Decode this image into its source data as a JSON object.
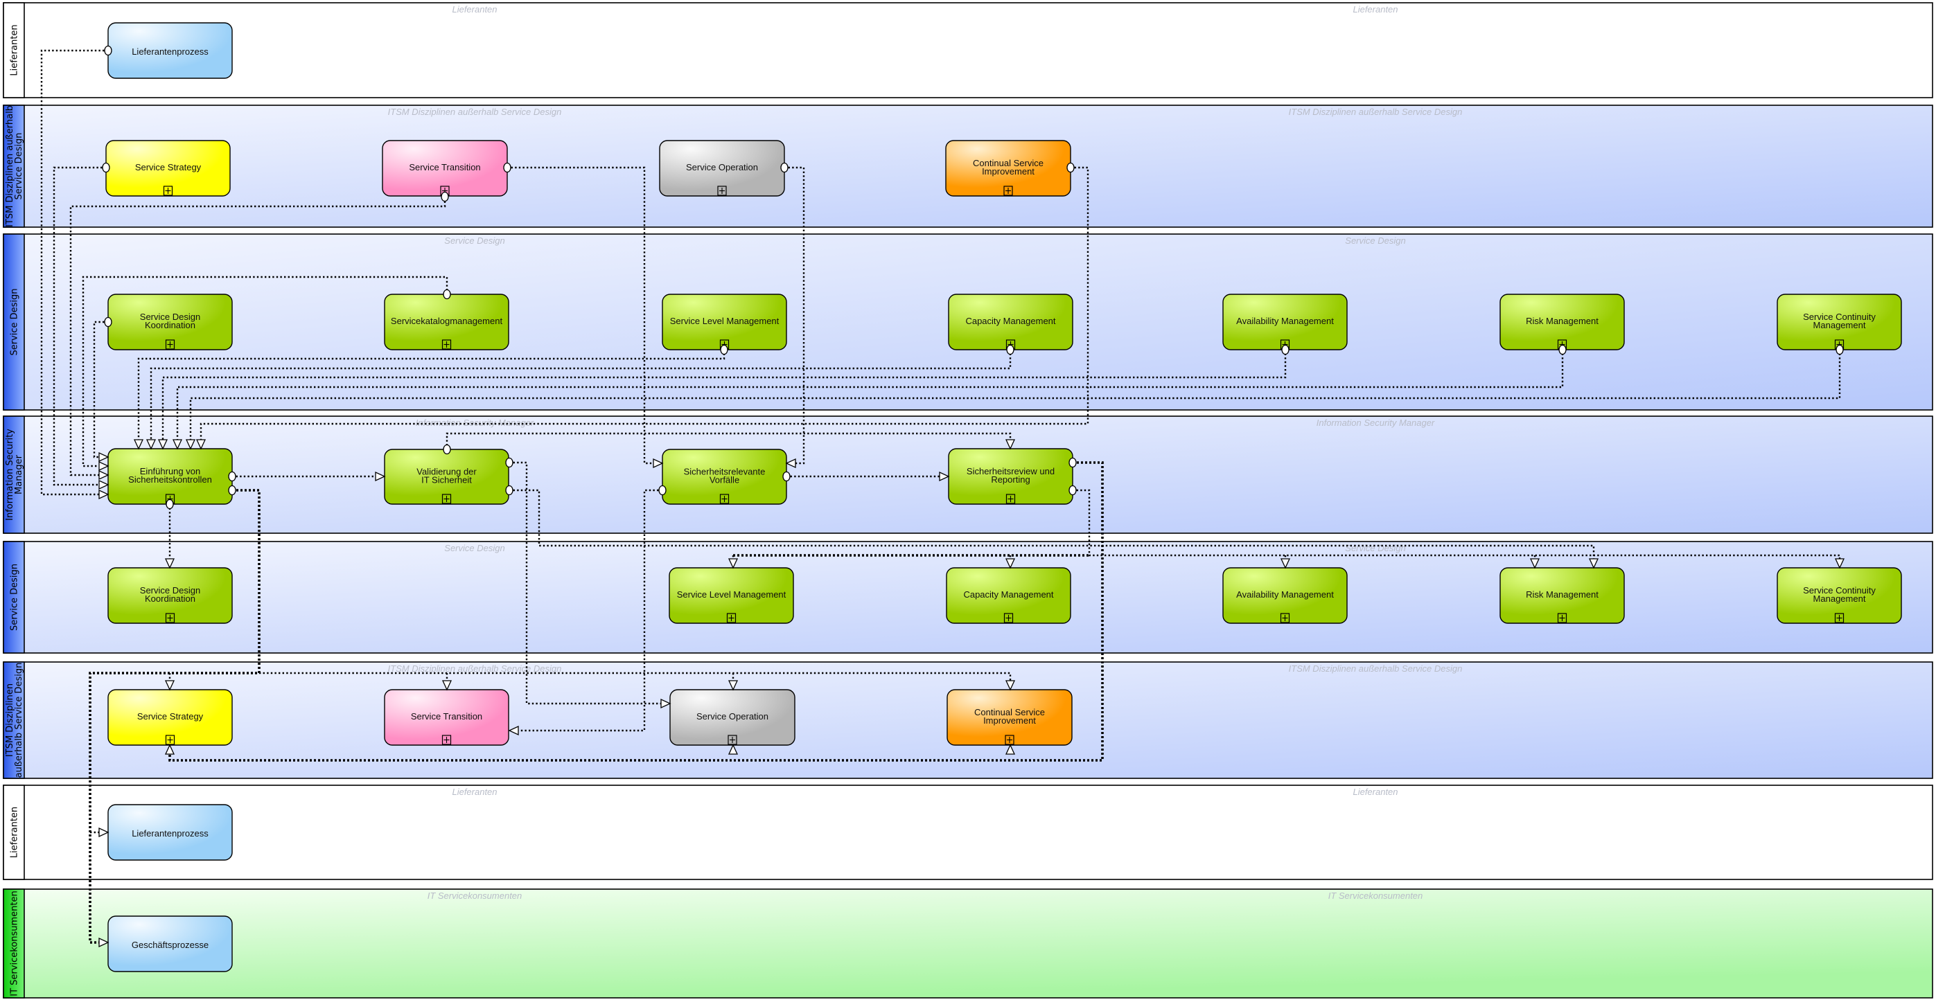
{
  "diagram": {
    "type": "swimlane-process-diagram",
    "lanes": [
      {
        "id": "l1",
        "title": "Lieferanten",
        "watermarks": [
          "Lieferanten",
          "Lieferanten"
        ],
        "style": "white"
      },
      {
        "id": "l2",
        "title": "ITSM Disziplinen außerhalb Service Design",
        "title_lines": [
          "ITSM Disziplinen außerhalb",
          "Service Design"
        ],
        "watermarks": [
          "ITSM Disziplinen außerhalb Service Design",
          "ITSM Disziplinen außerhalb Service Design"
        ],
        "style": "blue"
      },
      {
        "id": "l3",
        "title": "Service Design",
        "title_lines": [
          "Service Design"
        ],
        "watermarks": [
          "Service Design",
          "Service Design"
        ],
        "style": "blue"
      },
      {
        "id": "l4",
        "title": "Information Security Manager",
        "title_lines": [
          "Information Security",
          "Manager"
        ],
        "watermarks": [
          "Information Security Manager",
          "Information Security Manager"
        ],
        "style": "blue"
      },
      {
        "id": "l5",
        "title": "Service Design",
        "title_lines": [
          "Service Design"
        ],
        "watermarks": [
          "Service Design",
          "Service Design"
        ],
        "style": "blue"
      },
      {
        "id": "l6",
        "title": "ITSM Disziplinen außerhalb Service Design",
        "title_lines": [
          "ITSM Disziplinen",
          "außerhalb Service Design"
        ],
        "watermarks": [
          "ITSM Disziplinen außerhalb Service Design",
          "ITSM Disziplinen außerhalb Service Design"
        ],
        "style": "blue"
      },
      {
        "id": "l7",
        "title": "Lieferanten",
        "title_lines": [
          "Lieferanten"
        ],
        "watermarks": [
          "Lieferanten",
          "Lieferanten"
        ],
        "style": "white"
      },
      {
        "id": "l8",
        "title": "IT Servicekonsumenten",
        "title_lines": [
          "IT Servicekonsumenten"
        ],
        "watermarks": [
          "IT Servicekonsumenten",
          "IT Servicekonsumenten"
        ],
        "style": "green"
      }
    ],
    "nodes": [
      {
        "id": "n_lief1",
        "lane": "l1",
        "label_lines": [
          "Lieferantenprozess"
        ],
        "color": "blue",
        "expandable": false
      },
      {
        "id": "n_ss1",
        "lane": "l2",
        "label_lines": [
          "Service Strategy"
        ],
        "color": "yellow",
        "expandable": true
      },
      {
        "id": "n_st1",
        "lane": "l2",
        "label_lines": [
          "Service Transition"
        ],
        "color": "pink",
        "expandable": true
      },
      {
        "id": "n_so1",
        "lane": "l2",
        "label_lines": [
          "Service Operation"
        ],
        "color": "gray",
        "expandable": true
      },
      {
        "id": "n_csi1",
        "lane": "l2",
        "label_lines": [
          "Continual Service",
          "Improvement"
        ],
        "color": "orange",
        "expandable": true
      },
      {
        "id": "n_sdk1",
        "lane": "l3",
        "label_lines": [
          "Service Design",
          "Koordination"
        ],
        "color": "green",
        "expandable": true
      },
      {
        "id": "n_skm",
        "lane": "l3",
        "label_lines": [
          "Servicekatalogmanagement"
        ],
        "color": "green",
        "expandable": true
      },
      {
        "id": "n_slm1",
        "lane": "l3",
        "label_lines": [
          "Service Level Management"
        ],
        "color": "green",
        "expandable": true
      },
      {
        "id": "n_cap1",
        "lane": "l3",
        "label_lines": [
          "Capacity Management"
        ],
        "color": "green",
        "expandable": true
      },
      {
        "id": "n_av1",
        "lane": "l3",
        "label_lines": [
          "Availability Management"
        ],
        "color": "green",
        "expandable": true
      },
      {
        "id": "n_risk1",
        "lane": "l3",
        "label_lines": [
          "Risk Management"
        ],
        "color": "green",
        "expandable": true
      },
      {
        "id": "n_scm1",
        "lane": "l3",
        "label_lines": [
          "Service Continuity",
          "Management"
        ],
        "color": "green",
        "expandable": true
      },
      {
        "id": "n_einf",
        "lane": "l4",
        "label_lines": [
          "Einführung von",
          "Sicherheitskontrollen"
        ],
        "color": "green",
        "expandable": true
      },
      {
        "id": "n_valid",
        "lane": "l4",
        "label_lines": [
          "Validierung der",
          "IT Sicherheit"
        ],
        "color": "green",
        "expandable": true
      },
      {
        "id": "n_vorf",
        "lane": "l4",
        "label_lines": [
          "Sicherheitsrelevante",
          "Vorfälle"
        ],
        "color": "green",
        "expandable": true
      },
      {
        "id": "n_review",
        "lane": "l4",
        "label_lines": [
          "Sicherheitsreview und",
          "Reporting"
        ],
        "color": "green",
        "expandable": true
      },
      {
        "id": "n_sdk2",
        "lane": "l5",
        "label_lines": [
          "Service Design",
          "Koordination"
        ],
        "color": "green",
        "expandable": true
      },
      {
        "id": "n_slm2",
        "lane": "l5",
        "label_lines": [
          "Service Level Management"
        ],
        "color": "green",
        "expandable": true
      },
      {
        "id": "n_cap2",
        "lane": "l5",
        "label_lines": [
          "Capacity Management"
        ],
        "color": "green",
        "expandable": true
      },
      {
        "id": "n_av2",
        "lane": "l5",
        "label_lines": [
          "Availability Management"
        ],
        "color": "green",
        "expandable": true
      },
      {
        "id": "n_risk2",
        "lane": "l5",
        "label_lines": [
          "Risk Management"
        ],
        "color": "green",
        "expandable": true
      },
      {
        "id": "n_scm2",
        "lane": "l5",
        "label_lines": [
          "Service Continuity",
          "Management"
        ],
        "color": "green",
        "expandable": true
      },
      {
        "id": "n_ss2",
        "lane": "l6",
        "label_lines": [
          "Service Strategy"
        ],
        "color": "yellow",
        "expandable": true
      },
      {
        "id": "n_st2",
        "lane": "l6",
        "label_lines": [
          "Service Transition"
        ],
        "color": "pink",
        "expandable": true
      },
      {
        "id": "n_so2",
        "lane": "l6",
        "label_lines": [
          "Service Operation"
        ],
        "color": "gray",
        "expandable": true
      },
      {
        "id": "n_csi2",
        "lane": "l6",
        "label_lines": [
          "Continual Service",
          "Improvement"
        ],
        "color": "orange",
        "expandable": true
      },
      {
        "id": "n_lief2",
        "lane": "l7",
        "label_lines": [
          "Lieferantenprozess"
        ],
        "color": "blue",
        "expandable": false
      },
      {
        "id": "n_gesch",
        "lane": "l8",
        "label_lines": [
          "Geschäftsprozesse"
        ],
        "color": "blue",
        "expandable": false
      }
    ],
    "edges": [
      {
        "from": "n_lief1",
        "to": "n_einf"
      },
      {
        "from": "n_ss1",
        "to": "n_einf"
      },
      {
        "from": "n_st1",
        "to": "n_einf"
      },
      {
        "from": "n_skm",
        "to": "n_einf"
      },
      {
        "from": "n_sdk1",
        "to": "n_einf"
      },
      {
        "from": "n_slm1",
        "to": "n_einf"
      },
      {
        "from": "n_cap1",
        "to": "n_einf"
      },
      {
        "from": "n_av1",
        "to": "n_einf"
      },
      {
        "from": "n_risk1",
        "to": "n_einf"
      },
      {
        "from": "n_scm1",
        "to": "n_einf"
      },
      {
        "from": "n_csi1",
        "to": "n_review"
      },
      {
        "from": "n_st1",
        "to": "n_vorf"
      },
      {
        "from": "n_so1",
        "to": "n_vorf"
      },
      {
        "from": "n_einf",
        "to": "n_valid"
      },
      {
        "from": "n_vorf",
        "to": "n_review"
      },
      {
        "from": "n_einf",
        "to": "n_sdk2"
      },
      {
        "from": "n_valid",
        "to": "n_so2"
      },
      {
        "from": "n_valid",
        "to": "n_risk2"
      },
      {
        "from": "n_vorf",
        "to": "n_st2"
      },
      {
        "from": "n_review",
        "to": "n_slm2"
      },
      {
        "from": "n_review",
        "to": "n_cap2"
      },
      {
        "from": "n_review",
        "to": "n_av2"
      },
      {
        "from": "n_review",
        "to": "n_risk2"
      },
      {
        "from": "n_review",
        "to": "n_scm2"
      },
      {
        "from": "n_review",
        "to": "n_ss2"
      },
      {
        "from": "n_review",
        "to": "n_so2"
      },
      {
        "from": "n_review",
        "to": "n_csi2"
      },
      {
        "from": "n_einf",
        "to": "n_ss2"
      },
      {
        "from": "n_einf",
        "to": "n_st2"
      },
      {
        "from": "n_einf",
        "to": "n_so2"
      },
      {
        "from": "n_einf",
        "to": "n_csi2"
      },
      {
        "from": "n_einf",
        "to": "n_lief2"
      },
      {
        "from": "n_einf",
        "to": "n_gesch"
      }
    ],
    "colors": {
      "lane_blue_header": "#3a66f0",
      "lane_blue_bg_light": "#eef2fe",
      "lane_blue_bg_dark": "#bccdfb",
      "lane_green_header": "#22dd22",
      "lane_green_bg_light": "#f2fff0",
      "lane_green_bg_dark": "#b4f8b0",
      "node_green": "#99cc00",
      "node_yellow": "#ffff00",
      "node_pink": "#ff88c0",
      "node_gray": "#bbbbbb",
      "node_orange": "#ff9900",
      "node_blue": "#99d0f8",
      "watermark": "#b8bcc8"
    }
  }
}
